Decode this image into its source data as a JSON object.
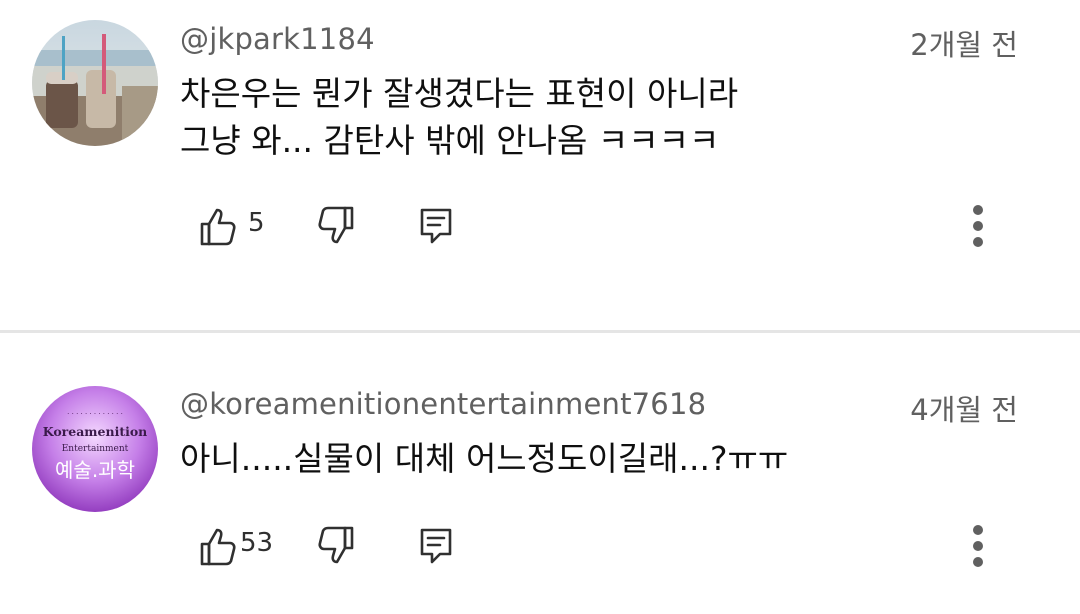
{
  "comments": [
    {
      "handle": "@jkpark1184",
      "time": "2개월 전",
      "lines": [
        "차은우는 뭔가 잘생겼다는 표현이 아니라",
        "그냥 와... 감탄사 밖에 안나옴 ㅋㅋㅋㅋ"
      ],
      "likes": "5"
    },
    {
      "handle": "@koreamenitionentertainment7618",
      "time": "4개월 전",
      "lines": [
        "아니.....실물이 대체 어느정도이길래...?ㅠㅠ"
      ],
      "likes": "53",
      "avatar_text": {
        "top": "Koreamenition",
        "mid": "Entertainment",
        "main": "예술.과학"
      }
    }
  ],
  "icons": {
    "like": "thumb-up-icon",
    "dislike": "thumb-down-icon",
    "reply": "reply-icon",
    "more": "more-vertical-icon"
  }
}
